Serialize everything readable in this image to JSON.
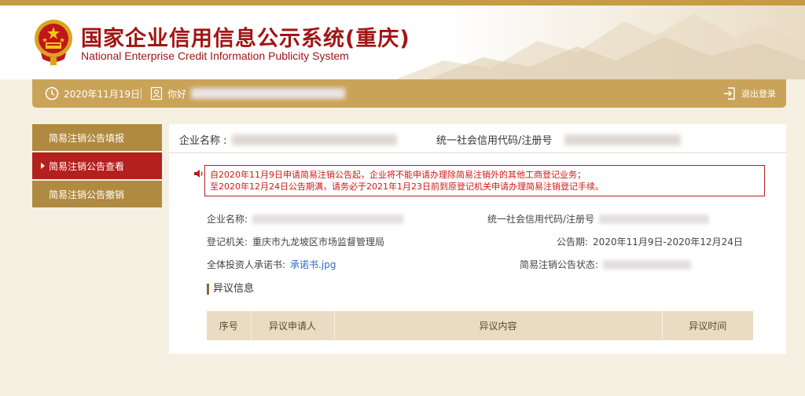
{
  "header": {
    "title_cn": "国家企业信用信息公示系统(重庆)",
    "title_en": "National Enterprise Credit Information Publicity System",
    "logo_icon": "national-emblem-icon"
  },
  "toolbar": {
    "date": "2020年11月19日",
    "greeting": "你好",
    "logout_label": "退出登录",
    "clock_icon": "clock-icon",
    "user_icon": "user-badge-icon",
    "logout_icon": "logout-icon"
  },
  "sidebar": {
    "items": [
      {
        "label": "简易注销公告填报",
        "active": false
      },
      {
        "label": "简易注销公告查看",
        "active": true
      },
      {
        "label": "简易注销公告撤销",
        "active": false
      }
    ]
  },
  "main": {
    "header": {
      "company_label": "企业名称 :",
      "credit_code_label": "统一社会信用代码/注册号"
    },
    "notice": {
      "line1": "自2020年11月9日申请简易注销公告起，企业将不能申请办理除简易注销外的其他工商登记业务；",
      "line2": "至2020年12月24日公告期满，请务必于2021年1月23日前到原登记机关申请办理简易注销登记手续。"
    },
    "details": {
      "company_label": "企业名称:",
      "credit_code_label": "统一社会信用代码/注册号",
      "authority_label": "登记机关:",
      "authority_value": "重庆市九龙坡区市场监督管理局",
      "period_label": "公告期:",
      "period_value": "2020年11月9日-2020年12月24日",
      "commitment_label": "全体投资人承诺书:",
      "commitment_link": "承诺书.jpg",
      "status_label": "简易注销公告状态:"
    },
    "objection": {
      "title": "异议信息",
      "columns": [
        "序号",
        "异议申请人",
        "异议内容",
        "异议时间"
      ]
    }
  },
  "colors": {
    "brand_red": "#a11515",
    "gold": "#c9a358",
    "sidebar_gold": "#b08a40",
    "active_red": "#b3201d",
    "notice_red": "#d01818",
    "link_blue": "#2d6bc1"
  }
}
